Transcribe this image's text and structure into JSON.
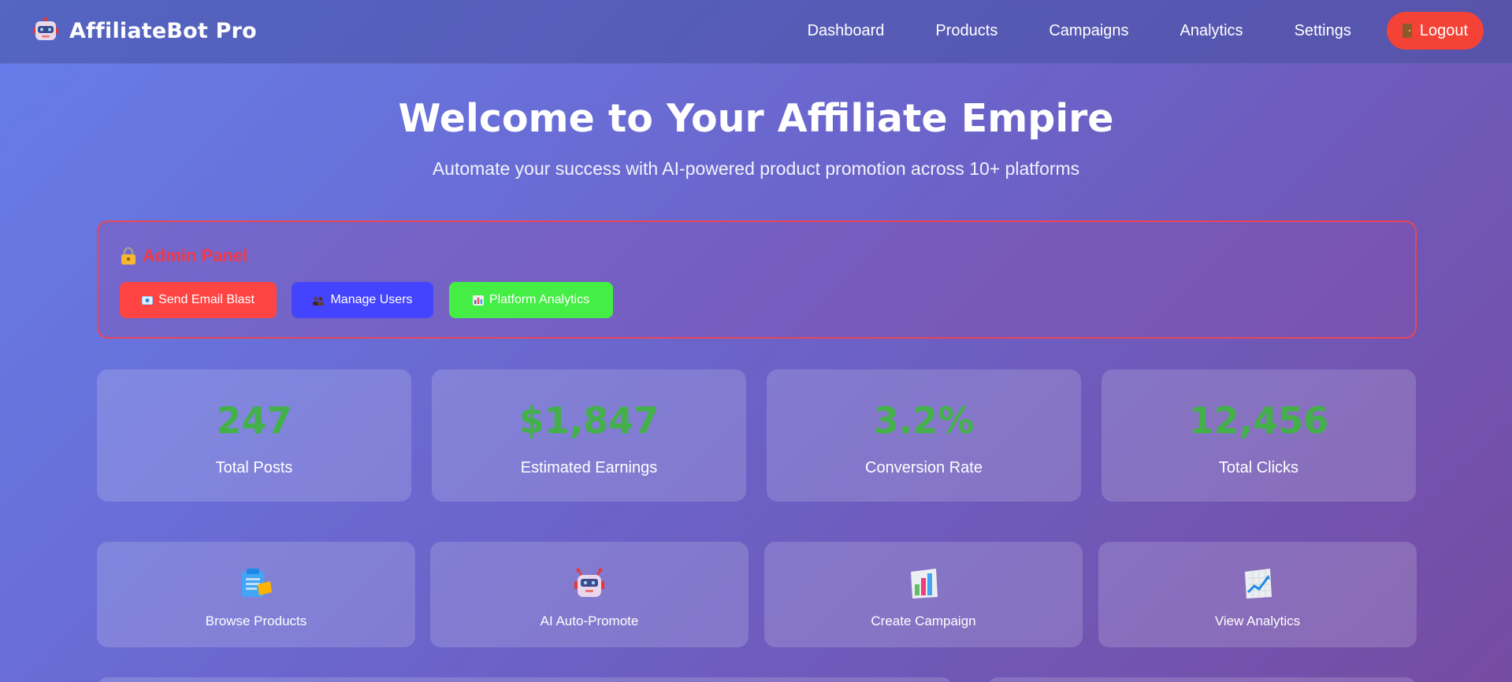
{
  "brand": {
    "title": "AffiliateBot Pro",
    "icon": "robot-icon"
  },
  "nav": {
    "links": [
      "Dashboard",
      "Products",
      "Campaigns",
      "Analytics",
      "Settings"
    ],
    "logout_label": "Logout",
    "logout_icon": "door-icon",
    "logout_color": "#f44336"
  },
  "hero": {
    "title": "Welcome to Your Affiliate Empire",
    "subtitle": "Automate your success with AI-powered product promotion across 10+ platforms"
  },
  "admin": {
    "title": "Admin Panel",
    "title_icon": "lock-icon",
    "title_color": "#f0394b",
    "buttons": [
      {
        "label": "Send Email Blast",
        "icon": "email-icon",
        "color": "#ff4444"
      },
      {
        "label": "Manage Users",
        "icon": "users-icon",
        "color": "#4444ff"
      },
      {
        "label": "Platform Analytics",
        "icon": "chart-icon",
        "color": "#44ee44"
      }
    ]
  },
  "stats": [
    {
      "value": "247",
      "label": "Total Posts"
    },
    {
      "value": "$1,847",
      "label": "Estimated Earnings"
    },
    {
      "value": "3.2%",
      "label": "Conversion Rate"
    },
    {
      "value": "12,456",
      "label": "Total Clicks"
    }
  ],
  "stat_value_color": "#43b04a",
  "actions": [
    {
      "label": "Browse Products",
      "icon": "clipboard-icon"
    },
    {
      "label": "AI Auto-Promote",
      "icon": "robot-icon"
    },
    {
      "label": "Create Campaign",
      "icon": "bar-chart-icon"
    },
    {
      "label": "View Analytics",
      "icon": "trend-chart-icon"
    }
  ]
}
